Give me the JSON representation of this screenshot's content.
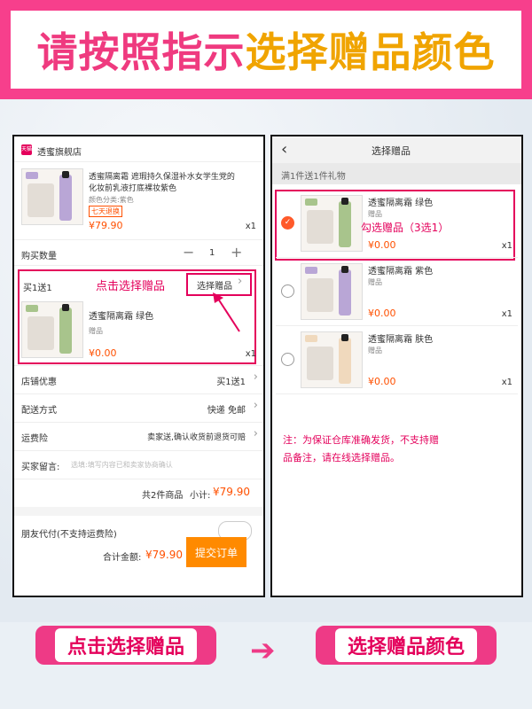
{
  "banner": {
    "part1": "请按照指示",
    "part2": "选择赠品颜色"
  },
  "left_panel": {
    "store_name": "透蜜旗舰店",
    "store_logo": "天猫",
    "product_title_line1": "透蜜隔离霜 遮瑕持久保湿补水女学生党的",
    "product_title_line2": "化妆前乳液打底裸妆紫色",
    "product_spec": "颜色分类:紫色",
    "product_tag": "七天退换",
    "product_price": "¥79.90",
    "product_qty": "x1",
    "quantity_label": "购买数量",
    "quantity_minus": "−",
    "quantity_value": "1",
    "quantity_plus": "+",
    "promo_label": "买1送1",
    "annotation": "点击选择赠品",
    "select_gift_button": "选择赠品",
    "gift_name": "透蜜隔离霜 绿色",
    "gift_label": "赠品",
    "gift_price": "¥0.00",
    "gift_qty": "x1",
    "shop_discount_label": "店铺优惠",
    "shop_discount_value": "买1送1",
    "shipping_label": "配送方式",
    "shipping_value": "快递 免邮",
    "insurance_label": "运费险",
    "insurance_value": "卖家送,确认收货前退货可赔",
    "message_label": "买家留言:",
    "message_placeholder": "选填:填写内容已和卖家协商确认",
    "summary_count": "共2件商品",
    "summary_subtotal_label": "小计:",
    "summary_subtotal": "¥79.90",
    "friend_pay_label": "朋友代付(不支持运费险)",
    "total_label": "合计金额:",
    "total_value": "¥79.90",
    "submit_button": "提交订单"
  },
  "right_panel": {
    "back_icon": "‹",
    "title": "选择赠品",
    "rule": "满1件送1件礼物",
    "annotation": "勾选赠品（3选1）",
    "gifts": [
      {
        "name": "透蜜隔离霜 绿色",
        "label": "赠品",
        "price": "¥0.00",
        "qty": "x1",
        "selected": true,
        "color": "#a8c48c"
      },
      {
        "name": "透蜜隔离霜 紫色",
        "label": "赠品",
        "price": "¥0.00",
        "qty": "x1",
        "selected": false,
        "color": "#b9a6d6"
      },
      {
        "name": "透蜜隔离霜 肤色",
        "label": "赠品",
        "price": "¥0.00",
        "qty": "x1",
        "selected": false,
        "color": "#f0d9bd"
      }
    ],
    "note_line1": "注：为保证仓库准确发货，不支持赠",
    "note_line2": "品备注，请在线选择赠品。"
  },
  "bottom": {
    "button1": "点击选择赠品",
    "arrow": "➔",
    "button2": "选择赠品颜色"
  },
  "colors": {
    "pink": "#ee3a86",
    "orange": "#ff5000",
    "red": "#e4005b"
  }
}
